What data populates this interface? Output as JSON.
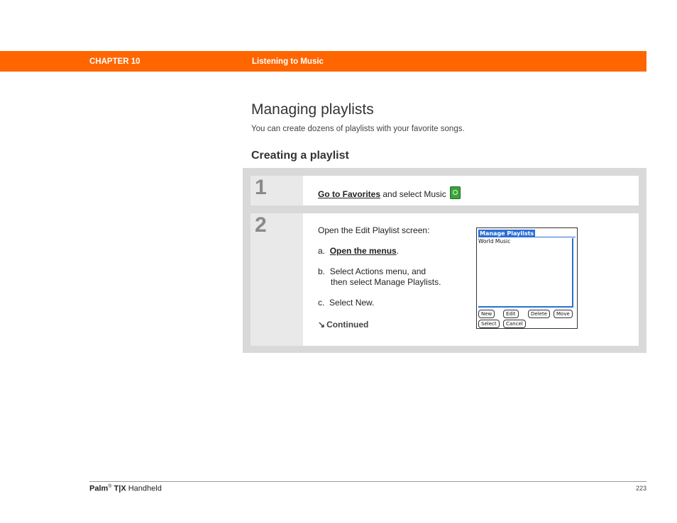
{
  "header": {
    "chapter": "CHAPTER 10",
    "section": "Listening to Music",
    "bar_color": "#ff6600"
  },
  "page": {
    "title": "Managing playlists",
    "subtitle": "You can create dozens of playlists with your favorite songs.",
    "section_title": "Creating a playlist"
  },
  "steps": [
    {
      "number": "1",
      "link": "Go to Favorites",
      "text": " and select Music",
      "icon": "music-app-icon"
    },
    {
      "number": "2",
      "intro": "Open the Edit Playlist screen:",
      "a_prefix": "a.",
      "a_link": "Open the menus",
      "a_suffix": ".",
      "b_prefix": "b.",
      "b_line1": "Select Actions menu, and",
      "b_line2": "then select Manage Playlists.",
      "c_prefix": "c.",
      "c_text": "Select New.",
      "continued": "Continued"
    }
  ],
  "palm_screen": {
    "title": "Manage Playlists",
    "items": [
      "World Music"
    ],
    "buttons": [
      "New",
      "Edit",
      "Delete",
      "Move",
      "Select",
      "Cancel"
    ],
    "accent": "#2b6fd6"
  },
  "footer": {
    "product_brand": "Palm",
    "registered": "®",
    "product_model": "T|X",
    "product_suffix": "Handheld",
    "page_number": "223"
  }
}
